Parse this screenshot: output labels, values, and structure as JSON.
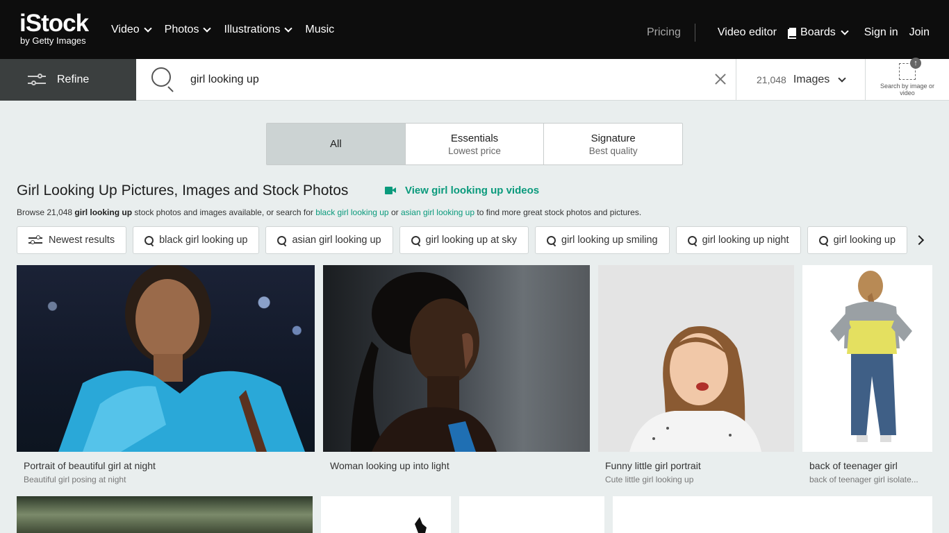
{
  "brand": {
    "name": "iStock",
    "tagline": "by Getty Images"
  },
  "nav": {
    "left": [
      {
        "label": "Video"
      },
      {
        "label": "Photos"
      },
      {
        "label": "Illustrations"
      },
      {
        "label": "Music"
      }
    ],
    "pricing": "Pricing",
    "video_editor": "Video editor",
    "boards": "Boards",
    "sign_in": "Sign in",
    "join": "Join"
  },
  "search": {
    "refine_label": "Refine",
    "query": "girl looking up",
    "result_count": "21,048",
    "media_type": "Images",
    "search_by_image": "Search by image or video"
  },
  "tabs": [
    {
      "title": "All",
      "subtitle": ""
    },
    {
      "title": "Essentials",
      "subtitle": "Lowest price"
    },
    {
      "title": "Signature",
      "subtitle": "Best quality"
    }
  ],
  "results": {
    "title": "Girl Looking Up Pictures, Images and Stock Photos",
    "video_link": "View girl looking up videos",
    "desc": {
      "prefix": "Browse 21,048 ",
      "term": "girl looking up",
      "mid1": " stock photos and images available, or search for ",
      "link1": "black girl looking up",
      "mid2": " or ",
      "link2": "asian girl looking up",
      "suffix": " to find more great stock photos and pictures."
    }
  },
  "chips": [
    {
      "label": "Newest results",
      "icon": "sliders-icon"
    },
    {
      "label": "black girl looking up",
      "icon": "search-icon"
    },
    {
      "label": "asian girl looking up",
      "icon": "search-icon"
    },
    {
      "label": "girl looking up at sky",
      "icon": "search-icon"
    },
    {
      "label": "girl looking up smiling",
      "icon": "search-icon"
    },
    {
      "label": "girl looking up night",
      "icon": "search-icon"
    },
    {
      "label": "girl looking up",
      "icon": "search-icon"
    }
  ],
  "images": [
    {
      "title": "Portrait of beautiful girl at night",
      "subtitle": "Beautiful girl posing at night"
    },
    {
      "title": "Woman looking up into light",
      "subtitle": ""
    },
    {
      "title": "Funny little girl portrait",
      "subtitle": "Cute little girl looking up"
    },
    {
      "title": "back of teenager girl",
      "subtitle": "back of teenager girl isolate..."
    }
  ],
  "colors": {
    "accent": "#0a9a7c",
    "topbar": "#0d0d0d",
    "page_bg": "#e9eeee"
  }
}
